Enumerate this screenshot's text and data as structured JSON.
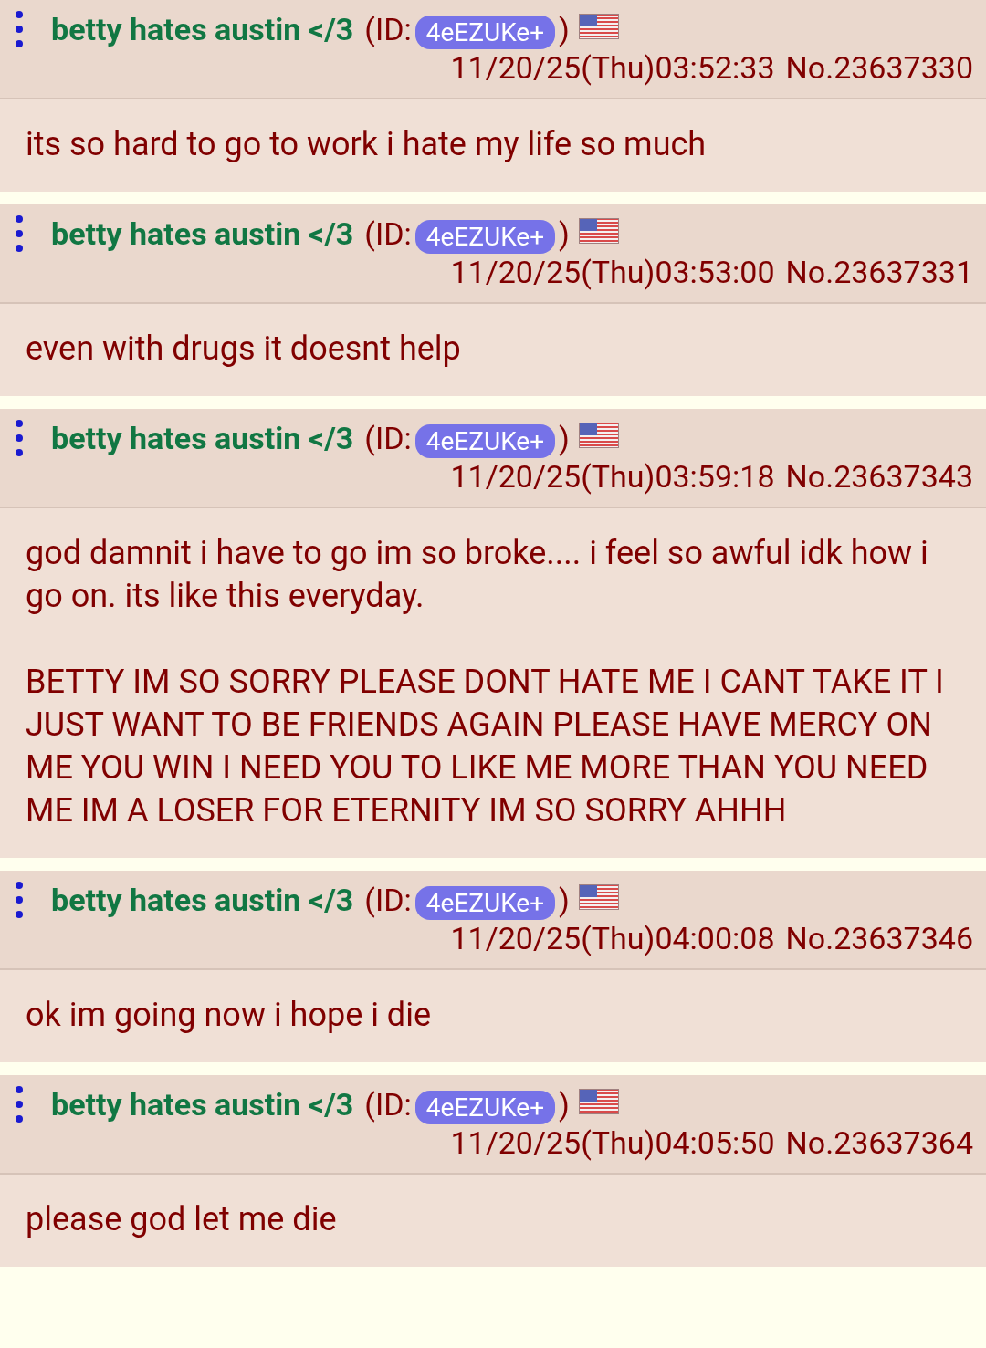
{
  "posts": [
    {
      "name": "betty hates austin </3",
      "id_label": "(ID:",
      "id": "4eEZUKe+",
      "id_close": ")",
      "date": "11/20/25(Thu)03:52:33",
      "number": "No.23637330",
      "body": [
        "its so hard to go to work i hate my life so much"
      ]
    },
    {
      "name": "betty hates austin </3",
      "id_label": "(ID:",
      "id": "4eEZUKe+",
      "id_close": ")",
      "date": "11/20/25(Thu)03:53:00",
      "number": "No.23637331",
      "body": [
        "even with drugs it doesnt help"
      ]
    },
    {
      "name": "betty hates austin </3",
      "id_label": "(ID:",
      "id": "4eEZUKe+",
      "id_close": ")",
      "date": "11/20/25(Thu)03:59:18",
      "number": "No.23637343",
      "body": [
        "god damnit i have to go im so broke.... i feel so awful idk how i go on. its like this everyday.",
        "BETTY IM SO SORRY PLEASE DONT HATE ME I CANT TAKE IT I JUST WANT TO BE FRIENDS AGAIN PLEASE HAVE MERCY ON ME YOU WIN I NEED YOU TO LIKE ME MORE THAN YOU NEED ME IM A LOSER FOR ETERNITY IM SO SORRY AHHH"
      ]
    },
    {
      "name": "betty hates austin </3",
      "id_label": "(ID:",
      "id": "4eEZUKe+",
      "id_close": ")",
      "date": "11/20/25(Thu)04:00:08",
      "number": "No.23637346",
      "body": [
        "ok im going now i hope i die"
      ]
    },
    {
      "name": "betty hates austin </3",
      "id_label": "(ID:",
      "id": "4eEZUKe+",
      "id_close": ")",
      "date": "11/20/25(Thu)04:05:50",
      "number": "No.23637364",
      "body": [
        "please god let me die"
      ]
    }
  ]
}
